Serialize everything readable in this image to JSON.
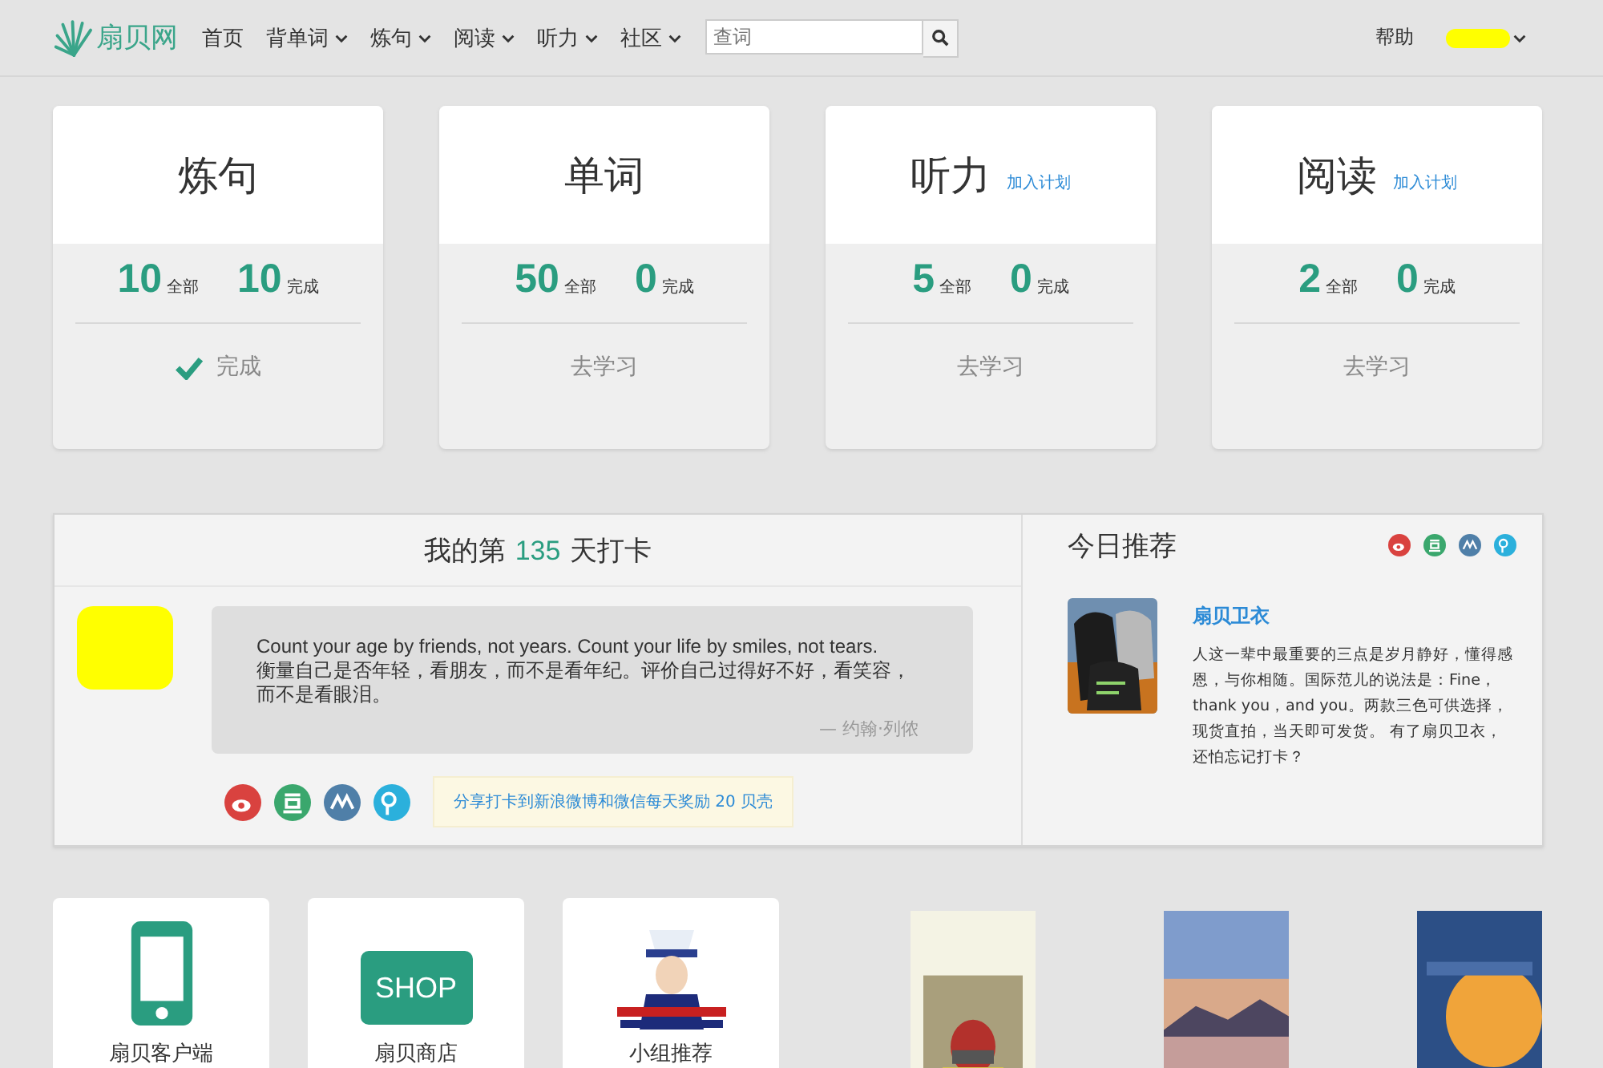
{
  "nav": {
    "logo": "扇贝网",
    "items": [
      {
        "label": "首页",
        "dropdown": false
      },
      {
        "label": "背单词",
        "dropdown": true
      },
      {
        "label": "炼句",
        "dropdown": true
      },
      {
        "label": "阅读",
        "dropdown": true
      },
      {
        "label": "听力",
        "dropdown": true
      },
      {
        "label": "社区",
        "dropdown": true
      }
    ],
    "search": {
      "placeholder": "查词"
    },
    "help": "帮助"
  },
  "cards": [
    {
      "title": "炼句",
      "total": "10",
      "total_label": "全部",
      "done": "10",
      "done_label": "完成",
      "action": "完成",
      "completed": true
    },
    {
      "title": "单词",
      "total": "50",
      "total_label": "全部",
      "done": "0",
      "done_label": "完成",
      "action": "去学习",
      "completed": false
    },
    {
      "title": "听力",
      "plan_link": "加入计划",
      "total": "5",
      "total_label": "全部",
      "done": "0",
      "done_label": "完成",
      "action": "去学习",
      "completed": false
    },
    {
      "title": "阅读",
      "plan_link": "加入计划",
      "total": "2",
      "total_label": "全部",
      "done": "0",
      "done_label": "完成",
      "action": "去学习",
      "completed": false
    }
  ],
  "checkin": {
    "prefix": "我的第",
    "days": "135",
    "suffix": "天打卡",
    "quote_en": "Count your age by friends, not years. Count your life by smiles, not tears.",
    "quote_zh": "衡量自己是否年轻，看朋友，而不是看年纪。评价自己过得好不好，看笑容，而不是看眼泪。",
    "author": "— 约翰·列侬",
    "share": [
      {
        "kind": "swirl",
        "color": "#d9423f"
      },
      {
        "kind": "bars",
        "color": "#3aa76d"
      },
      {
        "kind": "people",
        "color": "#4f7fa8"
      },
      {
        "kind": "loop",
        "color": "#2bb0dc"
      }
    ],
    "share_note": "分享打卡到新浪微博和微信每天奖励 20 贝壳"
  },
  "recommend": {
    "title": "今日推荐",
    "share": [
      {
        "kind": "swirl",
        "color": "#d9423f"
      },
      {
        "kind": "bars",
        "color": "#3aa76d"
      },
      {
        "kind": "people",
        "color": "#4f7fa8"
      },
      {
        "kind": "loop",
        "color": "#2bb0dc"
      }
    ],
    "product": "扇贝卫衣",
    "description": "人这一辈中最重要的三点是岁月静好，懂得感恩，与你相随。国际范儿的说法是：Fine，thank you，and you。两款三色可供选择，现货直拍，当天即可发货。 有了扇贝卫衣，还怕忘记打卡？"
  },
  "tiles": [
    {
      "kind": "phone",
      "label": "扇贝客户端"
    },
    {
      "kind": "shop",
      "label": "扇贝商店",
      "sign": "SHOP"
    },
    {
      "kind": "picture",
      "label": "小组推荐"
    }
  ]
}
